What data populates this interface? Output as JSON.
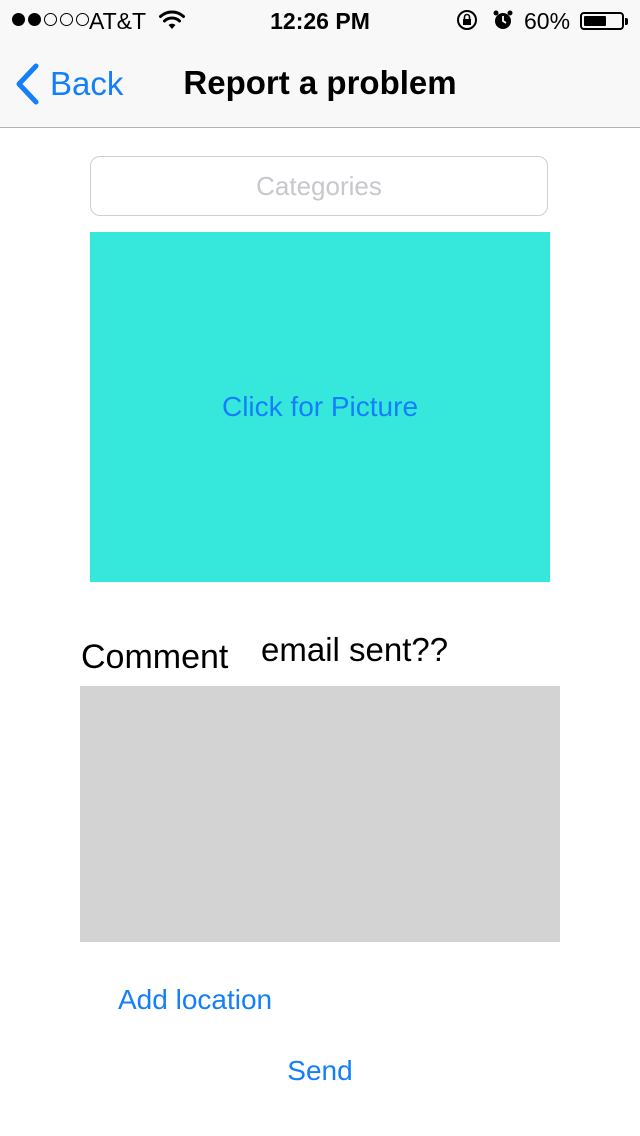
{
  "status_bar": {
    "signal_bars_filled": 2,
    "signal_bars_total": 5,
    "carrier": "AT&T",
    "time": "12:26 PM",
    "battery_percent_text": "60%",
    "battery_level": 0.6,
    "icons": [
      "wifi-icon",
      "orientation-lock-icon",
      "alarm-icon",
      "battery-icon"
    ]
  },
  "nav": {
    "back_label": "Back",
    "title": "Report a problem"
  },
  "form": {
    "categories_placeholder": "Categories",
    "picture_label": "Click for Picture",
    "comment_label": "Comment",
    "status_message": "email sent??",
    "comment_value": "",
    "add_location_label": "Add location",
    "send_label": "Send"
  },
  "colors": {
    "accent": "#147efb",
    "picture_bg": "#36e8dc",
    "comment_bg": "#d3d3d3"
  }
}
